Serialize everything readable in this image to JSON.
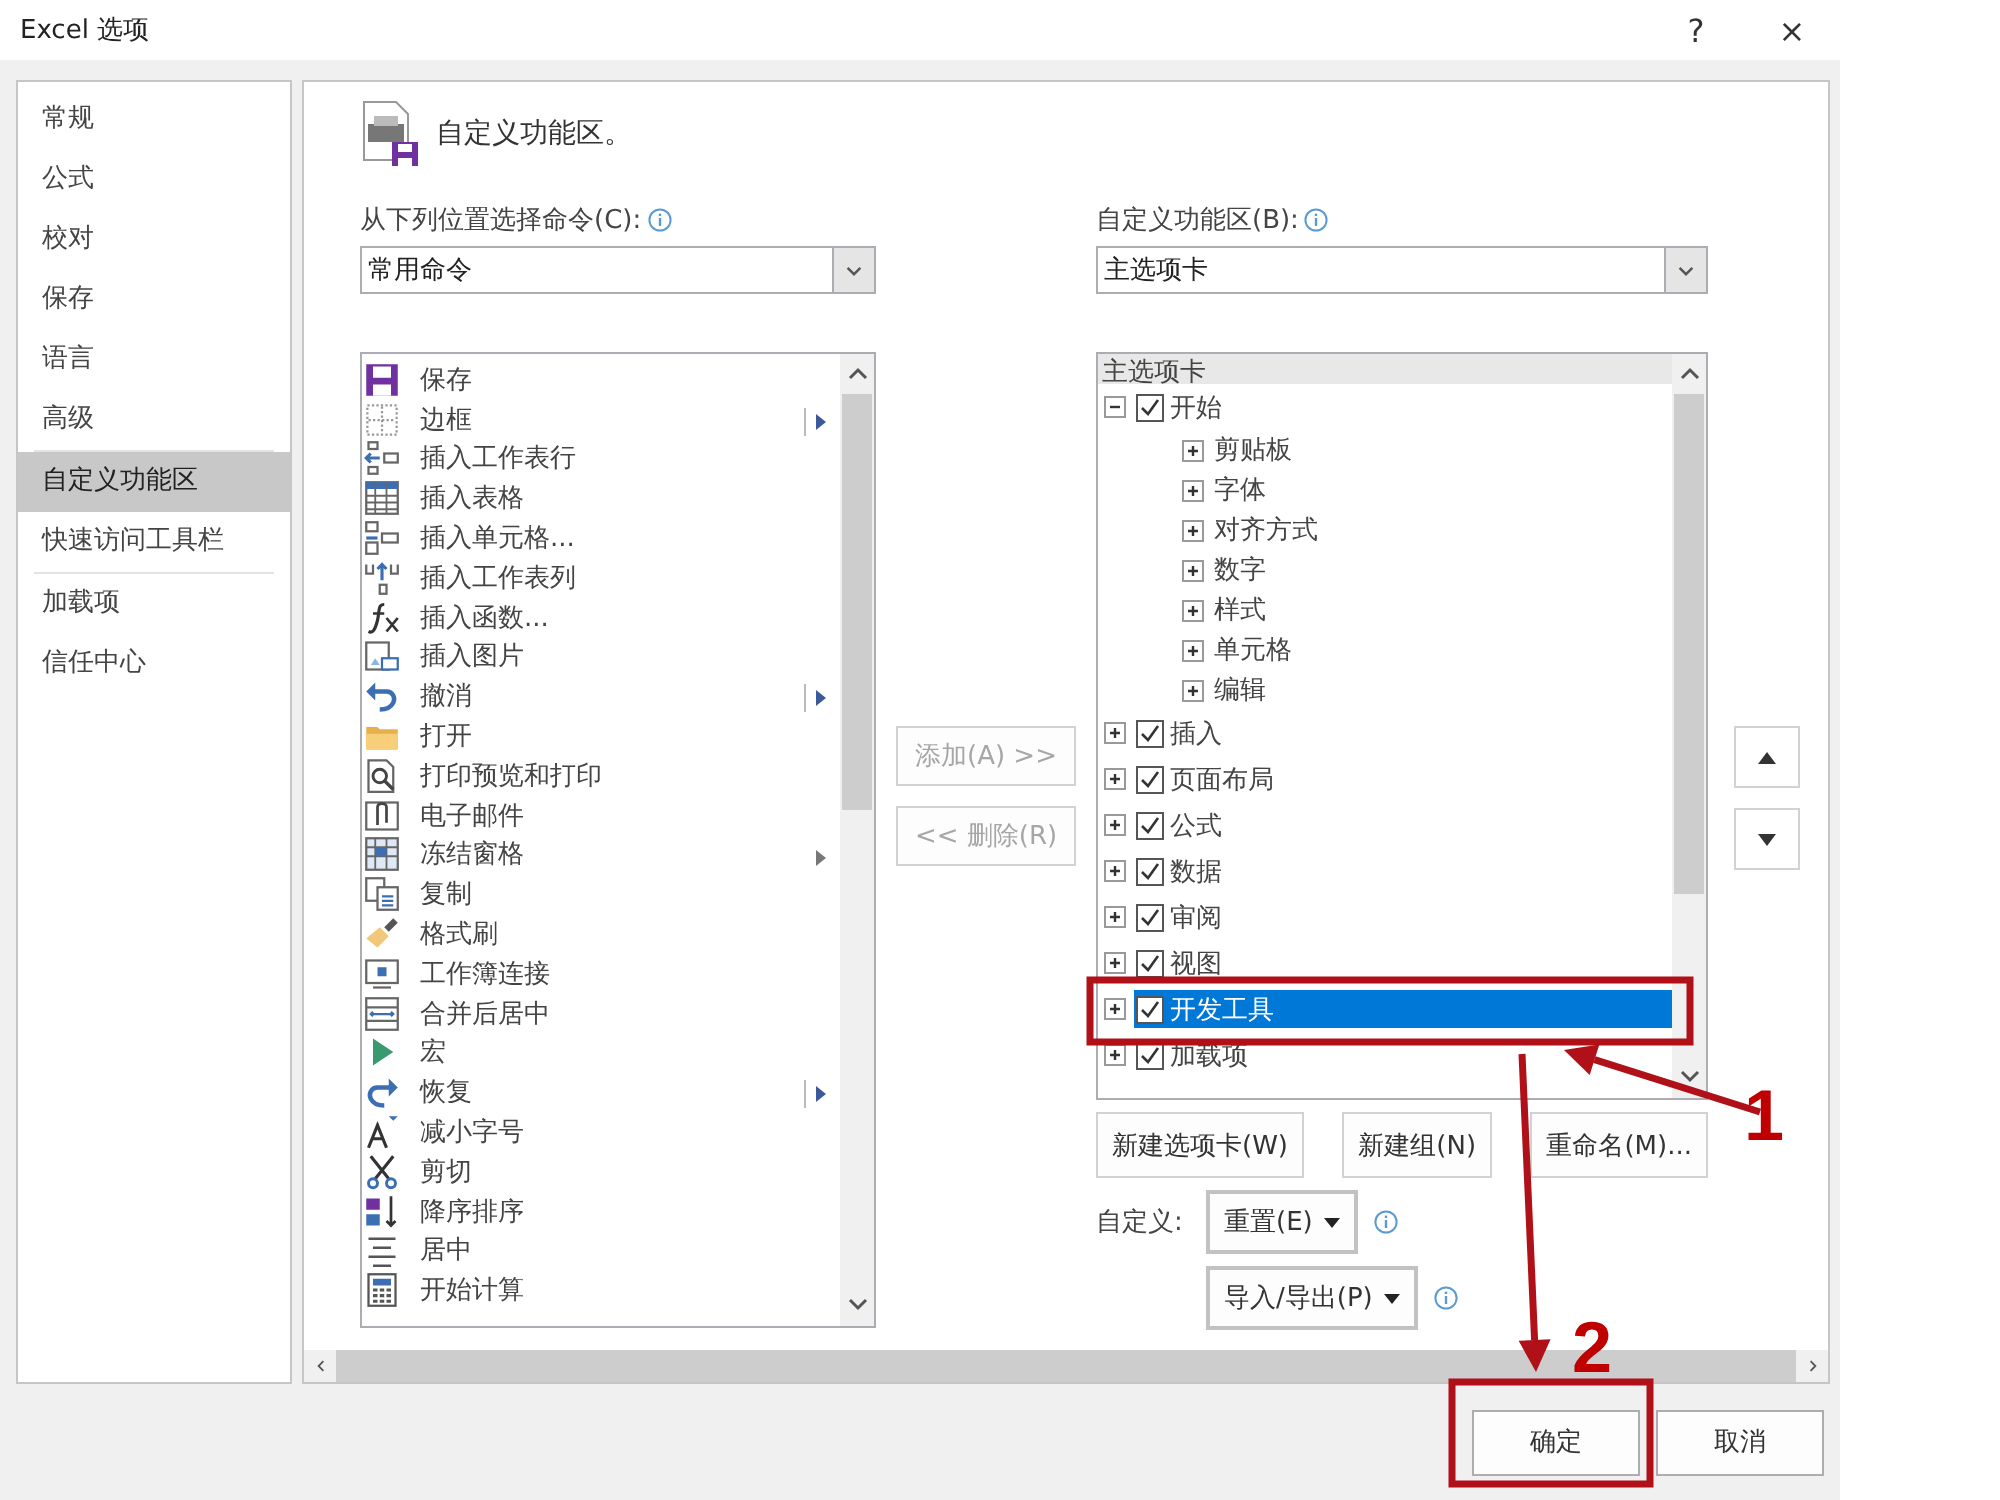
{
  "window": {
    "title": "Excel 选项",
    "help_button": "?",
    "close_button": "×"
  },
  "sidebar": {
    "groups": [
      [
        {
          "label": "常规",
          "selected": false
        },
        {
          "label": "公式",
          "selected": false
        },
        {
          "label": "校对",
          "selected": false
        },
        {
          "label": "保存",
          "selected": false
        },
        {
          "label": "语言",
          "selected": false
        },
        {
          "label": "高级",
          "selected": false
        }
      ],
      [
        {
          "label": "自定义功能区",
          "selected": true
        },
        {
          "label": "快速访问工具栏",
          "selected": false
        }
      ],
      [
        {
          "label": "加载项",
          "selected": false
        },
        {
          "label": "信任中心",
          "selected": false
        }
      ]
    ]
  },
  "main": {
    "heading": "自定义功能区。",
    "commands_from": {
      "label": "从下列位置选择命令(C):",
      "value": "常用命令"
    },
    "commands": [
      {
        "label": "保存",
        "submenu": false
      },
      {
        "label": "边框",
        "submenu": true,
        "split": true
      },
      {
        "label": "插入工作表行",
        "submenu": false
      },
      {
        "label": "插入表格",
        "submenu": false
      },
      {
        "label": "插入单元格...",
        "submenu": false
      },
      {
        "label": "插入工作表列",
        "submenu": false
      },
      {
        "label": "插入函数...",
        "submenu": false
      },
      {
        "label": "插入图片",
        "submenu": false
      },
      {
        "label": "撤消",
        "submenu": true,
        "split": true
      },
      {
        "label": "打开",
        "submenu": false
      },
      {
        "label": "打印预览和打印",
        "submenu": false
      },
      {
        "label": "电子邮件",
        "submenu": false
      },
      {
        "label": "冻结窗格",
        "submenu": true,
        "split": false
      },
      {
        "label": "复制",
        "submenu": false
      },
      {
        "label": "格式刷",
        "submenu": false
      },
      {
        "label": "工作簿连接",
        "submenu": false
      },
      {
        "label": "合并后居中",
        "submenu": false
      },
      {
        "label": "宏",
        "submenu": false
      },
      {
        "label": "恢复",
        "submenu": true,
        "split": true
      },
      {
        "label": "减小字号",
        "submenu": false
      },
      {
        "label": "剪切",
        "submenu": false
      },
      {
        "label": "降序排序",
        "submenu": false
      },
      {
        "label": "居中",
        "submenu": false
      },
      {
        "label": "开始计算",
        "submenu": false
      }
    ],
    "add_button": {
      "label": "添加(A) >>",
      "disabled": true
    },
    "remove_button": {
      "label": "<< 删除(R)",
      "disabled": true
    },
    "customize_ribbon": {
      "label": "自定义功能区(B):",
      "value": "主选项卡"
    },
    "tree": {
      "header": "主选项卡",
      "items": [
        {
          "label": "开始",
          "checked": true,
          "expanded": true,
          "selected": false,
          "children": [
            {
              "label": "剪贴板",
              "expanded": false,
              "selected": false
            },
            {
              "label": "字体",
              "expanded": false,
              "selected": false
            },
            {
              "label": "对齐方式",
              "expanded": false,
              "selected": false
            },
            {
              "label": "数字",
              "expanded": false,
              "selected": false
            },
            {
              "label": "样式",
              "expanded": false,
              "selected": false
            },
            {
              "label": "单元格",
              "expanded": false,
              "selected": false
            },
            {
              "label": "编辑",
              "expanded": false,
              "selected": false
            }
          ]
        },
        {
          "label": "插入",
          "checked": true,
          "expanded": false,
          "selected": false
        },
        {
          "label": "页面布局",
          "checked": true,
          "expanded": false,
          "selected": false
        },
        {
          "label": "公式",
          "checked": true,
          "expanded": false,
          "selected": false
        },
        {
          "label": "数据",
          "checked": true,
          "expanded": false,
          "selected": false
        },
        {
          "label": "审阅",
          "checked": true,
          "expanded": false,
          "selected": false
        },
        {
          "label": "视图",
          "checked": true,
          "expanded": false,
          "selected": false
        },
        {
          "label": "开发工具",
          "checked": true,
          "expanded": false,
          "selected": true
        },
        {
          "label": "加载项",
          "checked": true,
          "expanded": false,
          "selected": false
        }
      ]
    },
    "tree_buttons": [
      "新建选项卡(W)",
      "新建组(N)",
      "重命名(M)..."
    ],
    "customize_label": "自定义:",
    "reset_button": "重置(E)",
    "import_export_button": "导入/导出(P)"
  },
  "footer": {
    "ok_button": "确定",
    "cancel_button": "取消"
  },
  "annotations": [
    {
      "label": "1"
    },
    {
      "label": "2"
    }
  ]
}
